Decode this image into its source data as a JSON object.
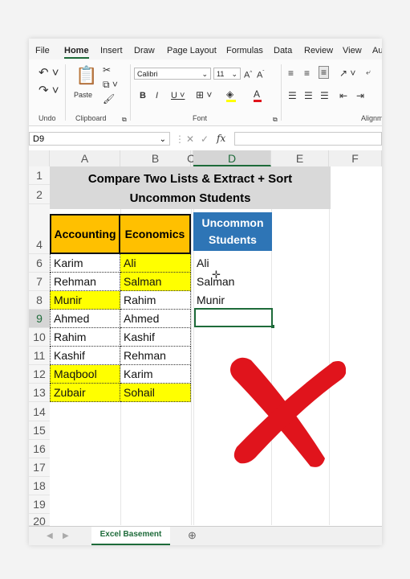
{
  "ribbon_tabs": [
    "File",
    "Home",
    "Insert",
    "Draw",
    "Page Layout",
    "Formulas",
    "Data",
    "Review",
    "View",
    "Au"
  ],
  "active_tab": "Home",
  "groups": {
    "undo": "Undo",
    "clipboard": "Clipboard",
    "font": "Font",
    "alignment": "Alignm"
  },
  "paste_label": "Paste",
  "font_name": "Calibri",
  "font_size": "11",
  "name_box": "D9",
  "fx_label": "fx",
  "columns": [
    "A",
    "B",
    "C",
    "D",
    "E",
    "F"
  ],
  "rows": [
    "1",
    "2",
    "4",
    "6",
    "7",
    "8",
    "9",
    "10",
    "11",
    "12",
    "13",
    "14",
    "15",
    "16",
    "17",
    "18",
    "19",
    "20"
  ],
  "title_line1": "Compare Two Lists & Extract + Sort",
  "title_line2": "Uncommon Students",
  "headers": {
    "accounting": "Accounting",
    "economics": "Economics",
    "uncommon_line1": "Uncommon",
    "uncommon_line2": "Students"
  },
  "accounting": [
    "Karim",
    "Rehman",
    "Munir",
    "Ahmed",
    "Rahim",
    "Kashif",
    "Maqbool",
    "Zubair"
  ],
  "economics": [
    "Ali",
    "Salman",
    "Rahim",
    "Ahmed",
    "Kashif",
    "Rehman",
    "Karim",
    "Sohail"
  ],
  "uncommon": [
    "Ali",
    "Salman",
    "Munir"
  ],
  "sheet_tab": "Excel Basement",
  "colors": {
    "excel_green": "#1e6b3a",
    "header_orange": "#ffc000",
    "header_blue": "#2e75b6",
    "highlight": "#ffff00",
    "title_bg": "#d9d9d9",
    "cross_red": "#e0141c"
  }
}
